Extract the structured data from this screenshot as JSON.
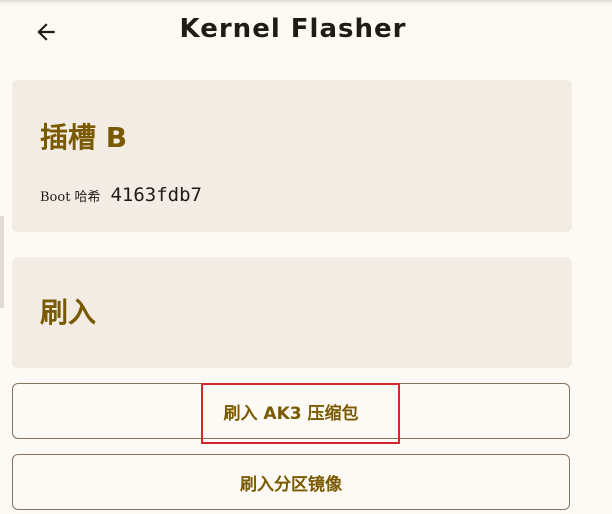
{
  "header": {
    "title": "Kernel Flasher",
    "back_icon": "arrow-left-icon"
  },
  "slot_card": {
    "title": "插槽 B",
    "hash_label": "Boot",
    "hash_label_cn": "哈希",
    "hash_value": "4163fdb7"
  },
  "flash_card": {
    "title": "刷入"
  },
  "buttons": {
    "flash_ak3": "刷入 AK3 压缩包",
    "flash_image": "刷入分区镜像"
  },
  "colors": {
    "background": "#fdfaf5",
    "card": "#f3ece4",
    "accent": "#7a5a00",
    "highlight": "#d3262d"
  }
}
